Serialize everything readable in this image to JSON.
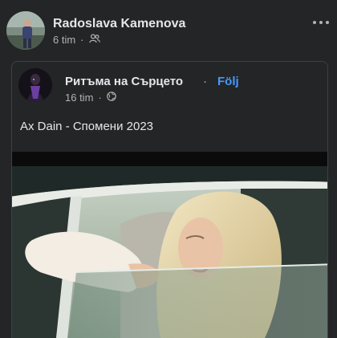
{
  "post": {
    "author": "Radoslava Kamenova",
    "time": "6 tim",
    "separator": "·",
    "audience_icon": "friends-icon",
    "more_icon": "more-options-icon"
  },
  "shared": {
    "page_name": "Ритъма на Сърцето",
    "separator": "·",
    "follow": "Följ",
    "time": "16 tim",
    "meta_separator": "·",
    "audience_icon": "globe-icon",
    "text": "Ax Dain - Спомени 2023"
  },
  "colors": {
    "background": "#242526",
    "text_primary": "#e4e6eb",
    "text_secondary": "#b0b3b8",
    "link": "#4599ff"
  }
}
